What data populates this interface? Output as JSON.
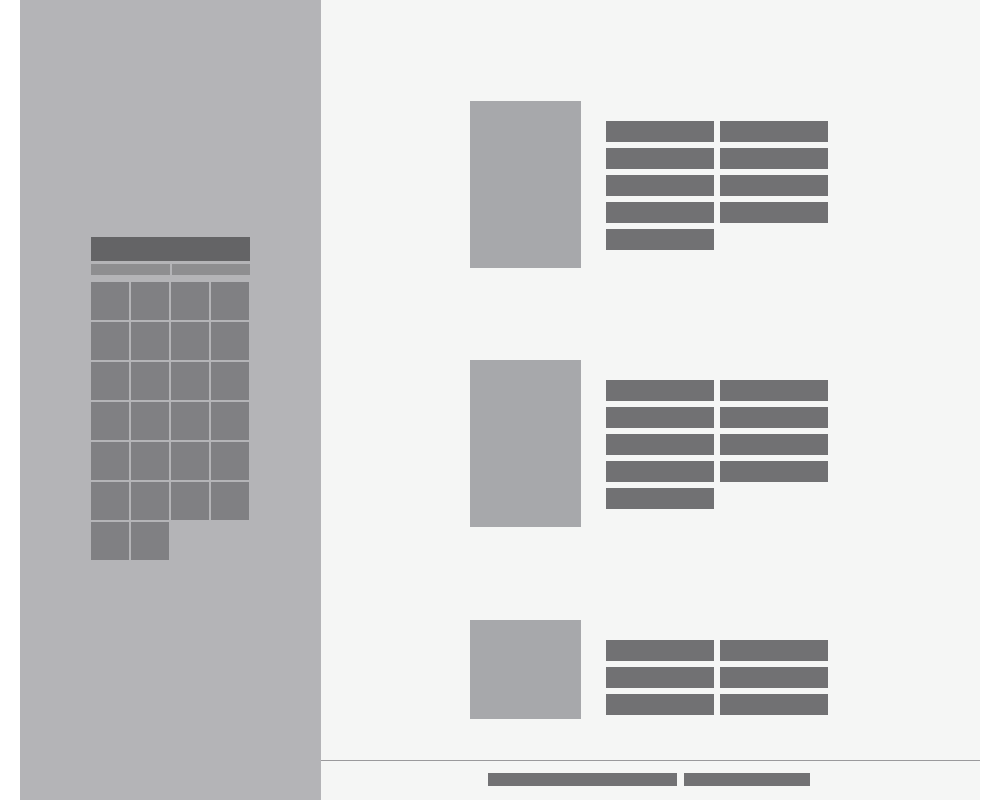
{
  "calendar": {
    "header": "",
    "nav": [
      "",
      ""
    ],
    "days": [
      "",
      "",
      "",
      "",
      "",
      "",
      "",
      "",
      "",
      "",
      "",
      "",
      "",
      "",
      "",
      "",
      "",
      "",
      "",
      "",
      "",
      "",
      "",
      "",
      "",
      ""
    ]
  },
  "entries": [
    {
      "fields": [
        "",
        "",
        "",
        "",
        "",
        "",
        "",
        "",
        ""
      ]
    },
    {
      "fields": [
        "",
        "",
        "",
        "",
        "",
        "",
        "",
        "",
        ""
      ]
    },
    {
      "fields": [
        "",
        "",
        "",
        "",
        "",
        ""
      ]
    }
  ],
  "footer": {
    "items": [
      "",
      ""
    ]
  }
}
